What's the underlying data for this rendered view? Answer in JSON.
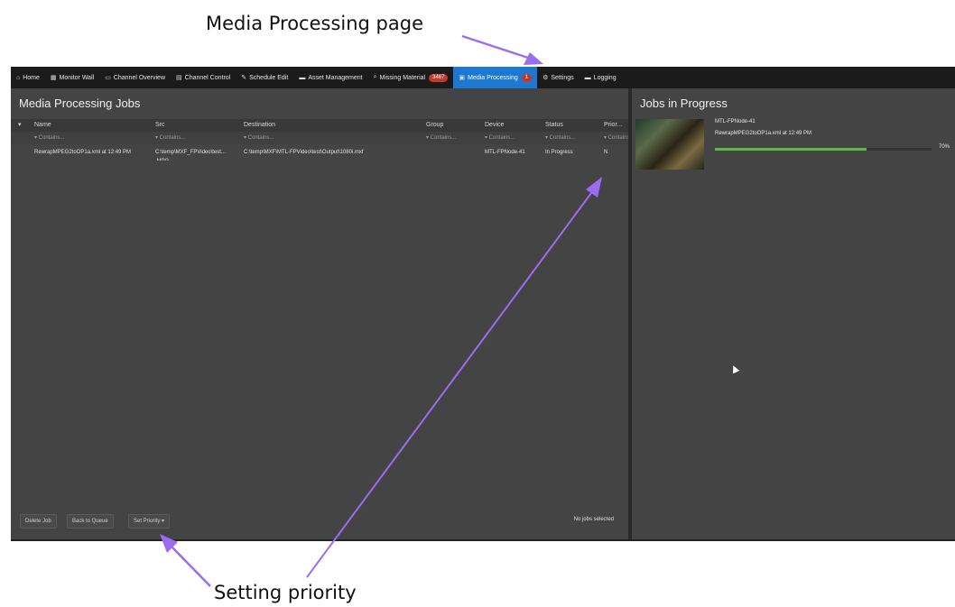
{
  "callouts": {
    "top": "Media Processing page",
    "bottom": "Setting priority"
  },
  "colors": {
    "arrow": "#9b6cf2",
    "active_tab": "#1e78d2",
    "badge": "#c0392b",
    "progress": "#58b848"
  },
  "nav": {
    "items": [
      {
        "icon": "home-icon",
        "glyph": "⌂",
        "label": "Home"
      },
      {
        "icon": "monitor-wall-icon",
        "glyph": "▦",
        "label": "Monitor Wall"
      },
      {
        "icon": "channel-overview-icon",
        "glyph": "▭",
        "label": "Channel Overview"
      },
      {
        "icon": "channel-control-icon",
        "glyph": "▤",
        "label": "Channel Control"
      },
      {
        "icon": "schedule-edit-icon",
        "glyph": "✎",
        "label": "Schedule Edit"
      },
      {
        "icon": "folder-icon",
        "glyph": "▬",
        "label": "Asset Management"
      },
      {
        "icon": "search-icon",
        "glyph": "⌕",
        "label": "Missing Material",
        "badge": "3467"
      },
      {
        "icon": "media-processing-icon",
        "glyph": "▣",
        "label": "Media Processing",
        "badge": "1"
      },
      {
        "icon": "gear-icon",
        "glyph": "⚙",
        "label": "Settings"
      },
      {
        "icon": "logging-icon",
        "glyph": "▬",
        "label": "Logging"
      }
    ]
  },
  "jobs_panel": {
    "title": "Media Processing Jobs",
    "columns": [
      "Name",
      "Src",
      "Destination",
      "Group",
      "Device",
      "Status",
      "Prior..."
    ],
    "filter_placeholder": "▾ Contains...",
    "rows": [
      {
        "name": "RewrapMPEG2toOP1a.xml at 12:49 PM",
        "src": "C:\\temp\\MXF_FPVideo\\test... .MPG",
        "destination": "C:\\temp\\MXF\\MTL-FPVideo\\test\\Output\\1080i.mxf",
        "group": "",
        "device": "MTL-FPNode-41",
        "status": "In Progress",
        "priority": "N"
      }
    ],
    "buttons": {
      "delete": "Delete Job",
      "back": "Back to Queue",
      "priority": "Set Priority ▾"
    },
    "status_text": "No jobs selected"
  },
  "progress_panel": {
    "title": "Jobs in Progress",
    "job": {
      "node": "MTL-FPNode-41",
      "name": "RewrapMPEG2toOP1a.xml at 12:49 PM",
      "progress": 70,
      "progress_label": "70%"
    }
  }
}
